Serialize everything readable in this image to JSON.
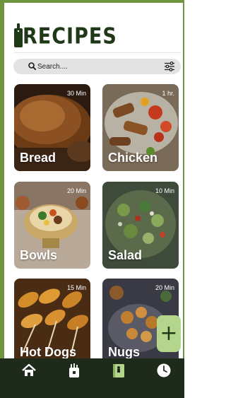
{
  "app": {
    "title": "RECIPES",
    "brand_color": "#1e3818",
    "accent_color": "#b4d68c"
  },
  "search": {
    "placeholder": "Search....",
    "value": ""
  },
  "recipes": [
    {
      "name": "Bread",
      "time": "30 Min"
    },
    {
      "name": "Chicken",
      "time": "1 hr."
    },
    {
      "name": "Bowls",
      "time": "20 Min"
    },
    {
      "name": "Salad",
      "time": "10 Min"
    },
    {
      "name": "Hot Dogs",
      "time": "15 Min"
    },
    {
      "name": "Nugs",
      "time": "20 Min"
    }
  ],
  "fab": {
    "label": "+"
  },
  "nav": {
    "items": [
      {
        "icon": "home-icon"
      },
      {
        "icon": "grocery-bag-icon"
      },
      {
        "icon": "recipe-book-icon"
      },
      {
        "icon": "clock-icon"
      }
    ]
  }
}
